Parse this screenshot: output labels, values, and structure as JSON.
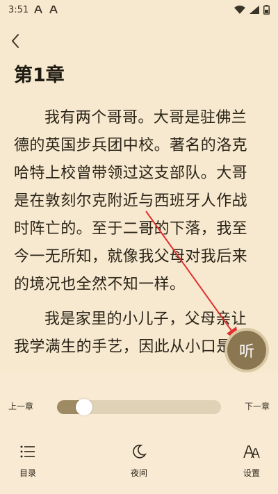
{
  "status_bar": {
    "time": "3:51",
    "left_icons": [
      "font-a-icon",
      "font-a-icon"
    ],
    "right_icons": [
      "wifi-icon",
      "signal-icon",
      "battery-icon"
    ]
  },
  "reader": {
    "chapter_title": "第1章",
    "paragraphs": [
      "我有两个哥哥。大哥是驻佛兰德的英国步兵团中校。著名的洛克哈特上校曾带领过这支部队。大哥是在敦刻尔克附近与西班牙人作战时阵亡的。至于二哥的下落，我至今一无所知，就像我父母对我后来的境况也全然不知一样。",
      "我是家里的小儿子，父母亲让我学满生的手艺，因此从小口是"
    ]
  },
  "listen_button": {
    "label": "听"
  },
  "progress": {
    "prev_label": "上一章",
    "next_label": "下一章",
    "value_percent": 14
  },
  "bottom_nav": {
    "items": [
      {
        "label": "目录",
        "icon": "menu-list-icon"
      },
      {
        "label": "夜间",
        "icon": "moon-icon"
      },
      {
        "label": "设置",
        "icon": "font-settings-icon"
      }
    ]
  },
  "colors": {
    "page_background": "#f7e9cf",
    "accent": "#8a7650",
    "slider_fill": "#9e8a63",
    "annotation_arrow": "#e03030"
  }
}
